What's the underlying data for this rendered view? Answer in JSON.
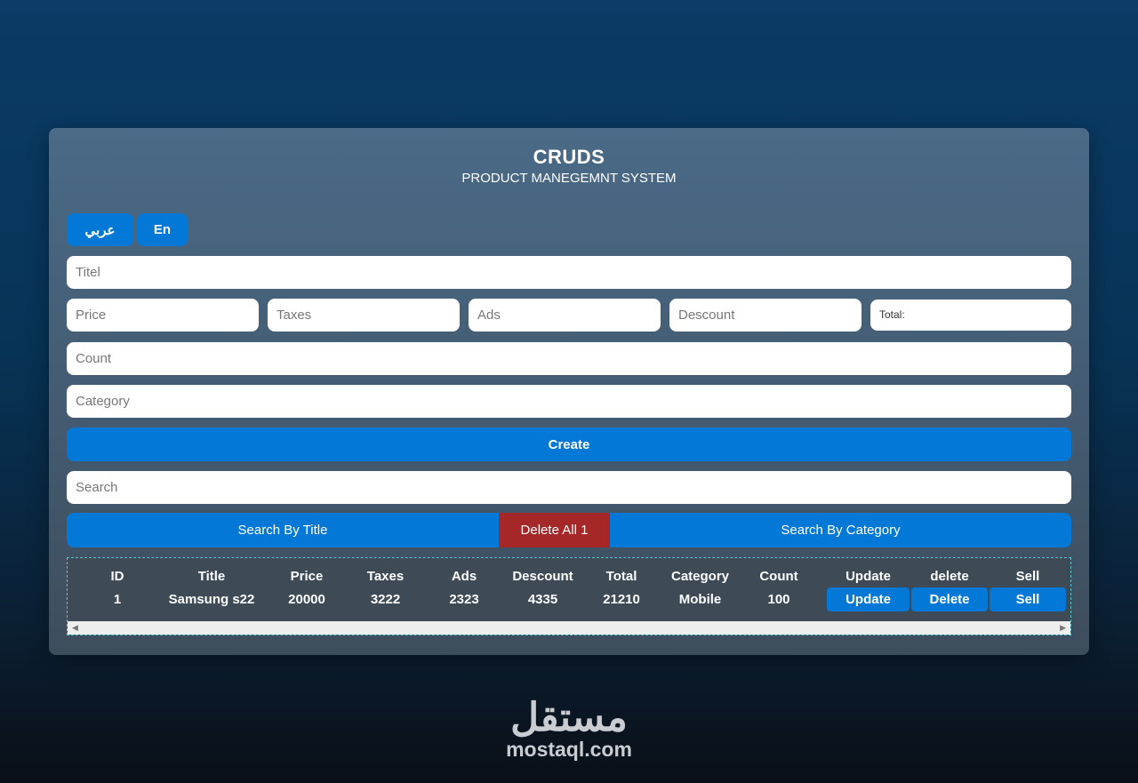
{
  "header": {
    "title": "CRUDS",
    "subtitle": "PRODUCT MANEGEMNT SYSTEM"
  },
  "lang": {
    "arabic": "عربي",
    "english": "En"
  },
  "form": {
    "title_placeholder": "Titel",
    "price_placeholder": "Price",
    "taxes_placeholder": "Taxes",
    "ads_placeholder": "Ads",
    "discount_placeholder": "Descount",
    "total_label": "Total:",
    "count_placeholder": "Count",
    "category_placeholder": "Category",
    "create_label": "Create"
  },
  "search": {
    "placeholder": "Search",
    "by_title": "Search By Title",
    "delete_all": "Delete All 1",
    "by_category": "Search By Category"
  },
  "table": {
    "headers": [
      "ID",
      "Title",
      "Price",
      "Taxes",
      "Ads",
      "Descount",
      "Total",
      "Category",
      "Count",
      "Update",
      "delete",
      "Sell"
    ],
    "rows": [
      {
        "id": "1",
        "title": "Samsung s22",
        "price": "20000",
        "taxes": "3222",
        "ads": "2323",
        "discount": "4335",
        "total": "21210",
        "category": "Mobile",
        "count": "100",
        "update": "Update",
        "delete": "Delete",
        "sell": "Sell"
      }
    ]
  },
  "footer_logo": {
    "arabic": "مستقل",
    "latin": "mostaql.com"
  },
  "colors": {
    "accent": "#0478d7",
    "danger": "#a52727",
    "card": "#445c73"
  }
}
